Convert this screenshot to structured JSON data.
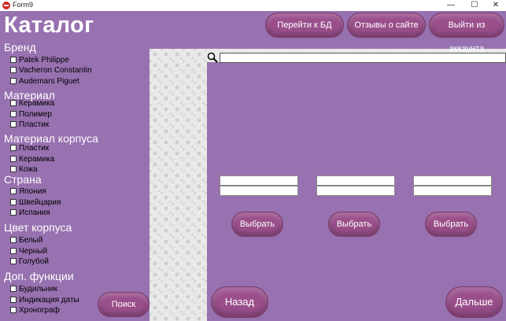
{
  "window": {
    "title": "Form9",
    "controls": {
      "minimize": "—",
      "maximize": "☐",
      "close": "✕"
    }
  },
  "header": {
    "title": "Каталог",
    "buttons": {
      "db": "Перейти к БД",
      "reviews": "Отзывы о сайте",
      "logout": "Выйти из аккаунта"
    }
  },
  "filters": {
    "brand": {
      "title": "Бренд",
      "options": [
        "Patek Philippe",
        "Vacheron Constantin",
        "Audemars Piguet"
      ]
    },
    "material": {
      "title": "Материал",
      "options": [
        "Керамика",
        "Полимер",
        "Пластик"
      ]
    },
    "case_material": {
      "title": "Материал корпуса",
      "options": [
        "Пластик",
        "Керамика",
        "Кожа"
      ]
    },
    "country": {
      "title": "Страна",
      "options": [
        "Япония",
        "Швейцария",
        "Испания"
      ]
    },
    "case_color": {
      "title": "Цвет корпуса",
      "options": [
        "Белый",
        "Черный",
        "Голубой"
      ]
    },
    "extra": {
      "title": "Доп. функции",
      "options": [
        "Будильник",
        "Индикация даты",
        "Хронограф"
      ]
    }
  },
  "search": {
    "value": "",
    "icon": "magnifier-icon"
  },
  "products": {
    "select_label": "Выбрать"
  },
  "footer": {
    "search_label": "Поиск",
    "back_label": "Назад",
    "next_label": "Дальше"
  },
  "colors": {
    "background": "#9771b0",
    "button": "#9a4f8b"
  }
}
